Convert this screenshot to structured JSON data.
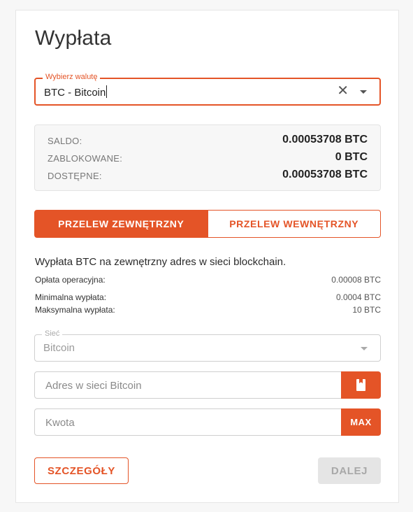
{
  "title": "Wypłata",
  "currency": {
    "legend": "Wybierz walutę",
    "value": "BTC - Bitcoin"
  },
  "balance": [
    {
      "label": "SALDO:",
      "value": "0.00053708 BTC"
    },
    {
      "label": "ZABLOKOWANE:",
      "value": "0 BTC"
    },
    {
      "label": "DOSTĘPNE:",
      "value": "0.00053708 BTC"
    }
  ],
  "tabs": {
    "external": "PRZELEW ZEWNĘTRZNY",
    "internal": "PRZELEW WEWNĘTRZNY"
  },
  "description": "Wypłata BTC na zewnętrzny adres w sieci blockchain.",
  "info": [
    {
      "label": "Opłata operacyjna:",
      "value": "0.00008 BTC"
    },
    {
      "label": "Minimalna wypłata:",
      "value": "0.0004 BTC"
    },
    {
      "label": "Maksymalna wypłata:",
      "value": "10 BTC"
    }
  ],
  "network": {
    "legend": "Sieć",
    "value": "Bitcoin"
  },
  "address": {
    "placeholder": "Adres w sieci Bitcoin"
  },
  "amount": {
    "placeholder": "Kwota",
    "max_label": "MAX"
  },
  "buttons": {
    "details": "SZCZEGÓŁY",
    "next": "DALEJ"
  },
  "colors": {
    "accent": "#e45427",
    "disabled_bg": "#e5e5e5"
  },
  "icons": {
    "clear": "close-icon",
    "dropdown": "chevron-down-icon",
    "address_book": "address-book-icon"
  }
}
